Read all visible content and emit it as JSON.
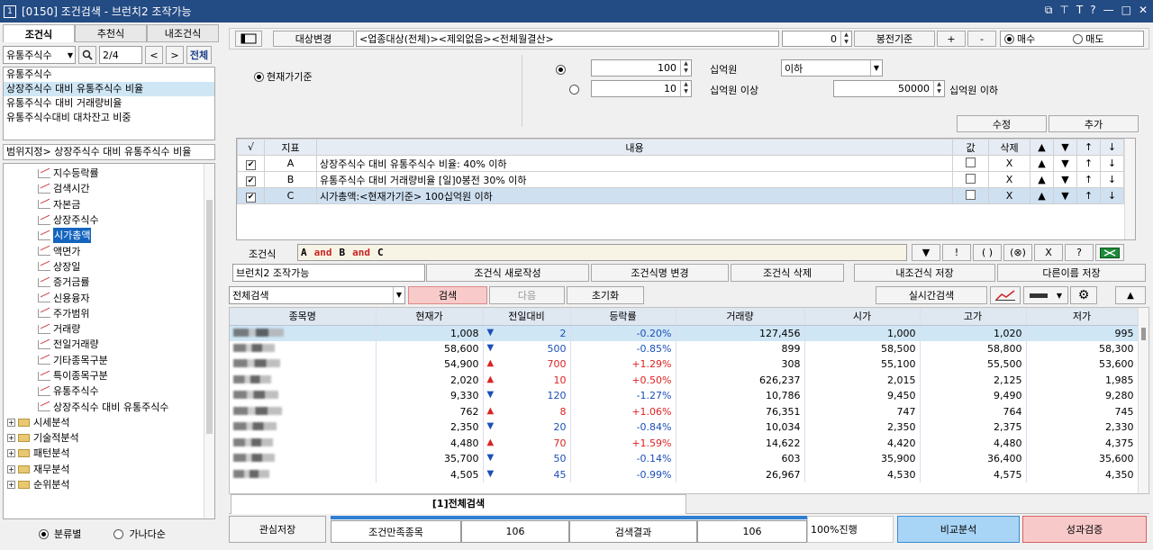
{
  "window": {
    "title": "[0150] 조건검색 - 브런치2 조작가능",
    "app_icon": "1",
    "controls": [
      "⧉",
      "⊤",
      "T",
      "?",
      "—",
      "□",
      "✕"
    ]
  },
  "left": {
    "tabs": [
      "조건식",
      "추천식",
      "내조건식"
    ],
    "search_value": "유통주식수",
    "page": "2/4",
    "all_label": "전체",
    "results": [
      "유통주식수",
      "상장주식수 대비 유통주식수 비율",
      "유통주식수 대비 거래량비율",
      "유통주식수대비 대차잔고 비중"
    ],
    "path": "범위지정> 상장주식수 대비 유통주식수 비율",
    "tree_items": [
      "지수등락률",
      "검색시간",
      "자본금",
      "상장주식수",
      "시가총액",
      "액면가",
      "상장일",
      "증거금률",
      "신용융자",
      "주가범위",
      "거래량",
      "전일거래량",
      "기타종목구분",
      "특이종목구분",
      "유통주식수",
      "상장주식수 대비 유통주식수"
    ],
    "folders": [
      "시세분석",
      "기술적분석",
      "패턴분석",
      "재무분석",
      "순위분석"
    ],
    "radio_category": "분류별",
    "radio_alpha": "가나다순"
  },
  "top": {
    "target_btn": "대상변경",
    "target_text": "<업종대상(전체)><제외없음><전체월결산>",
    "bar_value": "0",
    "bar_btn": "봉전기준",
    "plus": "+",
    "minus": "-",
    "buy": "매수",
    "sell": "매도"
  },
  "criteria": {
    "basis_label": "현재가기준",
    "value1": "100",
    "unit1": "십억원",
    "compare_select": "이하",
    "value2": "10",
    "unit2": "십억원 이상",
    "value3": "50000",
    "unit3": "십억원 이하",
    "edit_btn": "수정",
    "add_btn": "추가"
  },
  "cond_table": {
    "headers": [
      "√",
      "지표",
      "내용",
      "값",
      "삭제",
      "▲",
      "▼",
      "↑",
      "↓"
    ],
    "rows": [
      {
        "key": "A",
        "text": "상장주식수 대비 유통주식수 비율: 40% 이하",
        "del": "X"
      },
      {
        "key": "B",
        "text": "유통주식수 대비 거래량비율 [일]0봉전 30% 이하",
        "del": "X"
      },
      {
        "key": "C",
        "text": "시가총액:<현재가기준> 100십억원 이하",
        "del": "X"
      }
    ]
  },
  "formula": {
    "label": "조건식",
    "parts": [
      "A",
      "and",
      "B",
      "and",
      "C"
    ],
    "ops": [
      "▼",
      "!",
      "( )",
      "(⊗)",
      "X",
      "?"
    ]
  },
  "actions": {
    "name_value": "브런치2 조작가능",
    "new": "조건식 새로작성",
    "rename": "조건식명 변경",
    "delete": "조건식 삭제",
    "save_mine": "내조건식 저장",
    "save_as": "다른이름 저장"
  },
  "search_bar": {
    "scope": "전체검색",
    "search": "검색",
    "next": "다음",
    "reset": "초기화",
    "realtime": "실시간검색"
  },
  "results": {
    "headers": [
      "종목명",
      "현재가",
      "전일대비",
      "등락률",
      "거래량",
      "시가",
      "고가",
      "저가"
    ],
    "rows": [
      {
        "price": "1,008",
        "dir": "down",
        "chg": "2",
        "pct": "-0.20%",
        "vol": "127,456",
        "open": "1,000",
        "high": "1,020",
        "low": "995"
      },
      {
        "price": "58,600",
        "dir": "down",
        "chg": "500",
        "pct": "-0.85%",
        "vol": "899",
        "open": "58,500",
        "high": "58,800",
        "low": "58,300"
      },
      {
        "price": "54,900",
        "dir": "up",
        "chg": "700",
        "pct": "+1.29%",
        "vol": "308",
        "open": "55,100",
        "high": "55,500",
        "low": "53,600"
      },
      {
        "price": "2,020",
        "dir": "up",
        "chg": "10",
        "pct": "+0.50%",
        "vol": "626,237",
        "open": "2,015",
        "high": "2,125",
        "low": "1,985"
      },
      {
        "price": "9,330",
        "dir": "down",
        "chg": "120",
        "pct": "-1.27%",
        "vol": "10,786",
        "open": "9,450",
        "high": "9,490",
        "low": "9,280"
      },
      {
        "price": "762",
        "dir": "up",
        "chg": "8",
        "pct": "+1.06%",
        "vol": "76,351",
        "open": "747",
        "high": "764",
        "low": "745"
      },
      {
        "price": "2,350",
        "dir": "down",
        "chg": "20",
        "pct": "-0.84%",
        "vol": "10,034",
        "open": "2,350",
        "high": "2,375",
        "low": "2,330"
      },
      {
        "price": "4,480",
        "dir": "up",
        "chg": "70",
        "pct": "+1.59%",
        "vol": "14,622",
        "open": "4,420",
        "high": "4,480",
        "low": "4,375"
      },
      {
        "price": "35,700",
        "dir": "down",
        "chg": "50",
        "pct": "-0.14%",
        "vol": "603",
        "open": "35,900",
        "high": "36,400",
        "low": "35,600"
      },
      {
        "price": "4,505",
        "dir": "down",
        "chg": "45",
        "pct": "-0.99%",
        "vol": "26,967",
        "open": "4,530",
        "high": "4,575",
        "low": "4,350"
      }
    ],
    "tab": "[1]전체검색"
  },
  "footer": {
    "save_interest": "관심저장",
    "match_label": "조건만족종목",
    "match_count": "106",
    "result_label": "검색결과",
    "result_count": "106",
    "progress_text": "100%진행",
    "progress": 1.0,
    "compare": "비교분석",
    "verify": "성과검증"
  },
  "colors": {
    "title_bar": "#234b84",
    "up": "#d22222",
    "down": "#1a4fb8",
    "selection": "#cfe6f5",
    "compare_btn": "#a8d4f5",
    "verify_btn": "#f8c9c9"
  }
}
